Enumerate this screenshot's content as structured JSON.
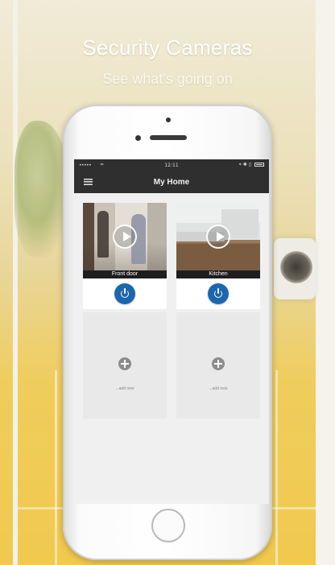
{
  "promo": {
    "headline": "Security Cameras",
    "subline": "See what's going on"
  },
  "status_bar": {
    "signal": "•••••",
    "wifi": "≈",
    "time": "12:11",
    "right_icons": "⌖ ✱ ▯"
  },
  "nav": {
    "menu_icon": "hamburger-icon",
    "title": "My Home"
  },
  "cameras": [
    {
      "label": "Front door",
      "icons": [
        "play-icon",
        "power-icon"
      ]
    },
    {
      "label": "Kitchen",
      "icons": [
        "play-icon",
        "power-icon"
      ]
    }
  ],
  "add_slots": [
    {
      "label": "...add new",
      "icon": "plus-circle-icon"
    },
    {
      "label": "...add new",
      "icon": "plus-circle-icon"
    }
  ],
  "colors": {
    "navbar": "#2f2f2f",
    "power_button": "#1c66b0",
    "background_yellow": "#f0c94e"
  }
}
